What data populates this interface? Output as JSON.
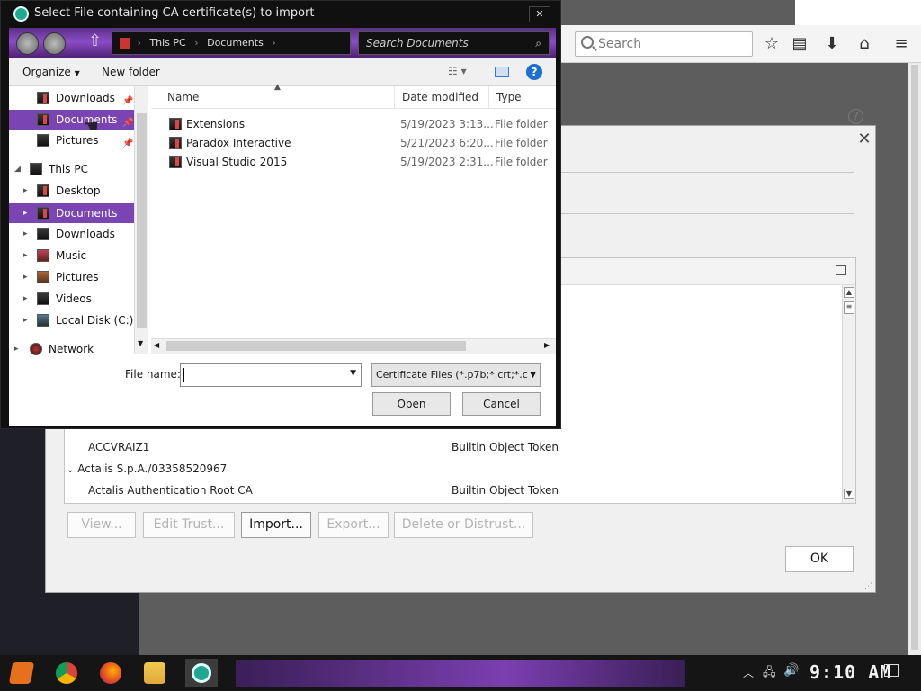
{
  "firefox": {
    "search_placeholder": "Search",
    "help_glyph": "?"
  },
  "cert_manager": {
    "close_glyph": "✕",
    "rows": [
      {
        "name": "ACCVRAIZ1",
        "token": "Builtin Object Token"
      },
      {
        "name": "Actalis S.p.A./03358520967",
        "token": "",
        "group": true
      },
      {
        "name": "Actalis Authentication Root CA",
        "token": "Builtin Object Token"
      }
    ],
    "buttons": {
      "view": "View...",
      "edit_trust": "Edit Trust...",
      "import": "Import...",
      "export": "Export...",
      "delete": "Delete or Distrust..."
    },
    "ok_label": "OK"
  },
  "file_dialog": {
    "title": "Select File containing CA certificate(s) to import",
    "breadcrumb": [
      "This PC",
      "Documents"
    ],
    "search_placeholder": "Search Documents",
    "organize_label": "Organize",
    "new_folder_label": "New folder",
    "help_glyph": "?",
    "nav_items": [
      {
        "label": "Downloads",
        "pinned": true,
        "indent": 1
      },
      {
        "label": "Documents",
        "pinned": true,
        "indent": 1,
        "selected": true
      },
      {
        "label": "Pictures",
        "pinned": true,
        "indent": 1
      },
      {
        "label": "This PC",
        "indent": 0,
        "expanded": true
      },
      {
        "label": "Desktop",
        "indent": 1
      },
      {
        "label": "Documents",
        "indent": 1,
        "selected": true
      },
      {
        "label": "Downloads",
        "indent": 1
      },
      {
        "label": "Music",
        "indent": 1
      },
      {
        "label": "Pictures",
        "indent": 1
      },
      {
        "label": "Videos",
        "indent": 1
      },
      {
        "label": "Local Disk (C:)",
        "indent": 1
      },
      {
        "label": "Network",
        "indent": 0
      }
    ],
    "columns": {
      "name": "Name",
      "date": "Date modified",
      "type": "Type"
    },
    "files": [
      {
        "name": "Extensions",
        "date": "5/19/2023 3:13...",
        "type": "File folder"
      },
      {
        "name": "Paradox Interactive",
        "date": "5/21/2023 6:20...",
        "type": "File folder"
      },
      {
        "name": "Visual Studio 2015",
        "date": "5/19/2023 2:31...",
        "type": "File folder"
      }
    ],
    "file_name_label": "File name:",
    "file_name_value": "",
    "file_type": "Certificate Files (*.p7b;*.crt;*.c",
    "open_label": "Open",
    "cancel_label": "Cancel"
  },
  "taskbar": {
    "clock": "9:10 AM"
  }
}
